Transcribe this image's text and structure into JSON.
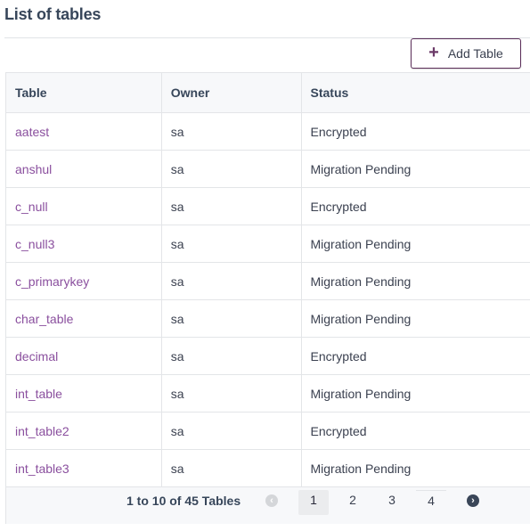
{
  "header": {
    "title": "List of tables",
    "add_button": {
      "icon": "plus-icon",
      "label": "Add Table"
    }
  },
  "table": {
    "columns": [
      "Table",
      "Owner",
      "Status"
    ],
    "rows": [
      {
        "table": "aatest",
        "owner": "sa",
        "status": "Encrypted"
      },
      {
        "table": "anshul",
        "owner": "sa",
        "status": "Migration Pending"
      },
      {
        "table": "c_null",
        "owner": "sa",
        "status": "Encrypted"
      },
      {
        "table": "c_null3",
        "owner": "sa",
        "status": "Migration Pending"
      },
      {
        "table": "c_primarykey",
        "owner": "sa",
        "status": "Migration Pending"
      },
      {
        "table": "char_table",
        "owner": "sa",
        "status": "Migration Pending"
      },
      {
        "table": "decimal",
        "owner": "sa",
        "status": "Encrypted"
      },
      {
        "table": "int_table",
        "owner": "sa",
        "status": "Migration Pending"
      },
      {
        "table": "int_table2",
        "owner": "sa",
        "status": "Encrypted"
      },
      {
        "table": "int_table3",
        "owner": "sa",
        "status": "Migration Pending"
      }
    ]
  },
  "pagination": {
    "summary": "1 to 10 of 45 Tables",
    "prev_icon": "chevron-left-icon",
    "next_icon": "chevron-right-icon",
    "pages": [
      "1",
      "2",
      "3",
      "4"
    ],
    "current_page": "1"
  },
  "colors": {
    "link": "#8a4f9e",
    "button_border": "#5b2e59",
    "header_bg": "#f7f8fa"
  }
}
